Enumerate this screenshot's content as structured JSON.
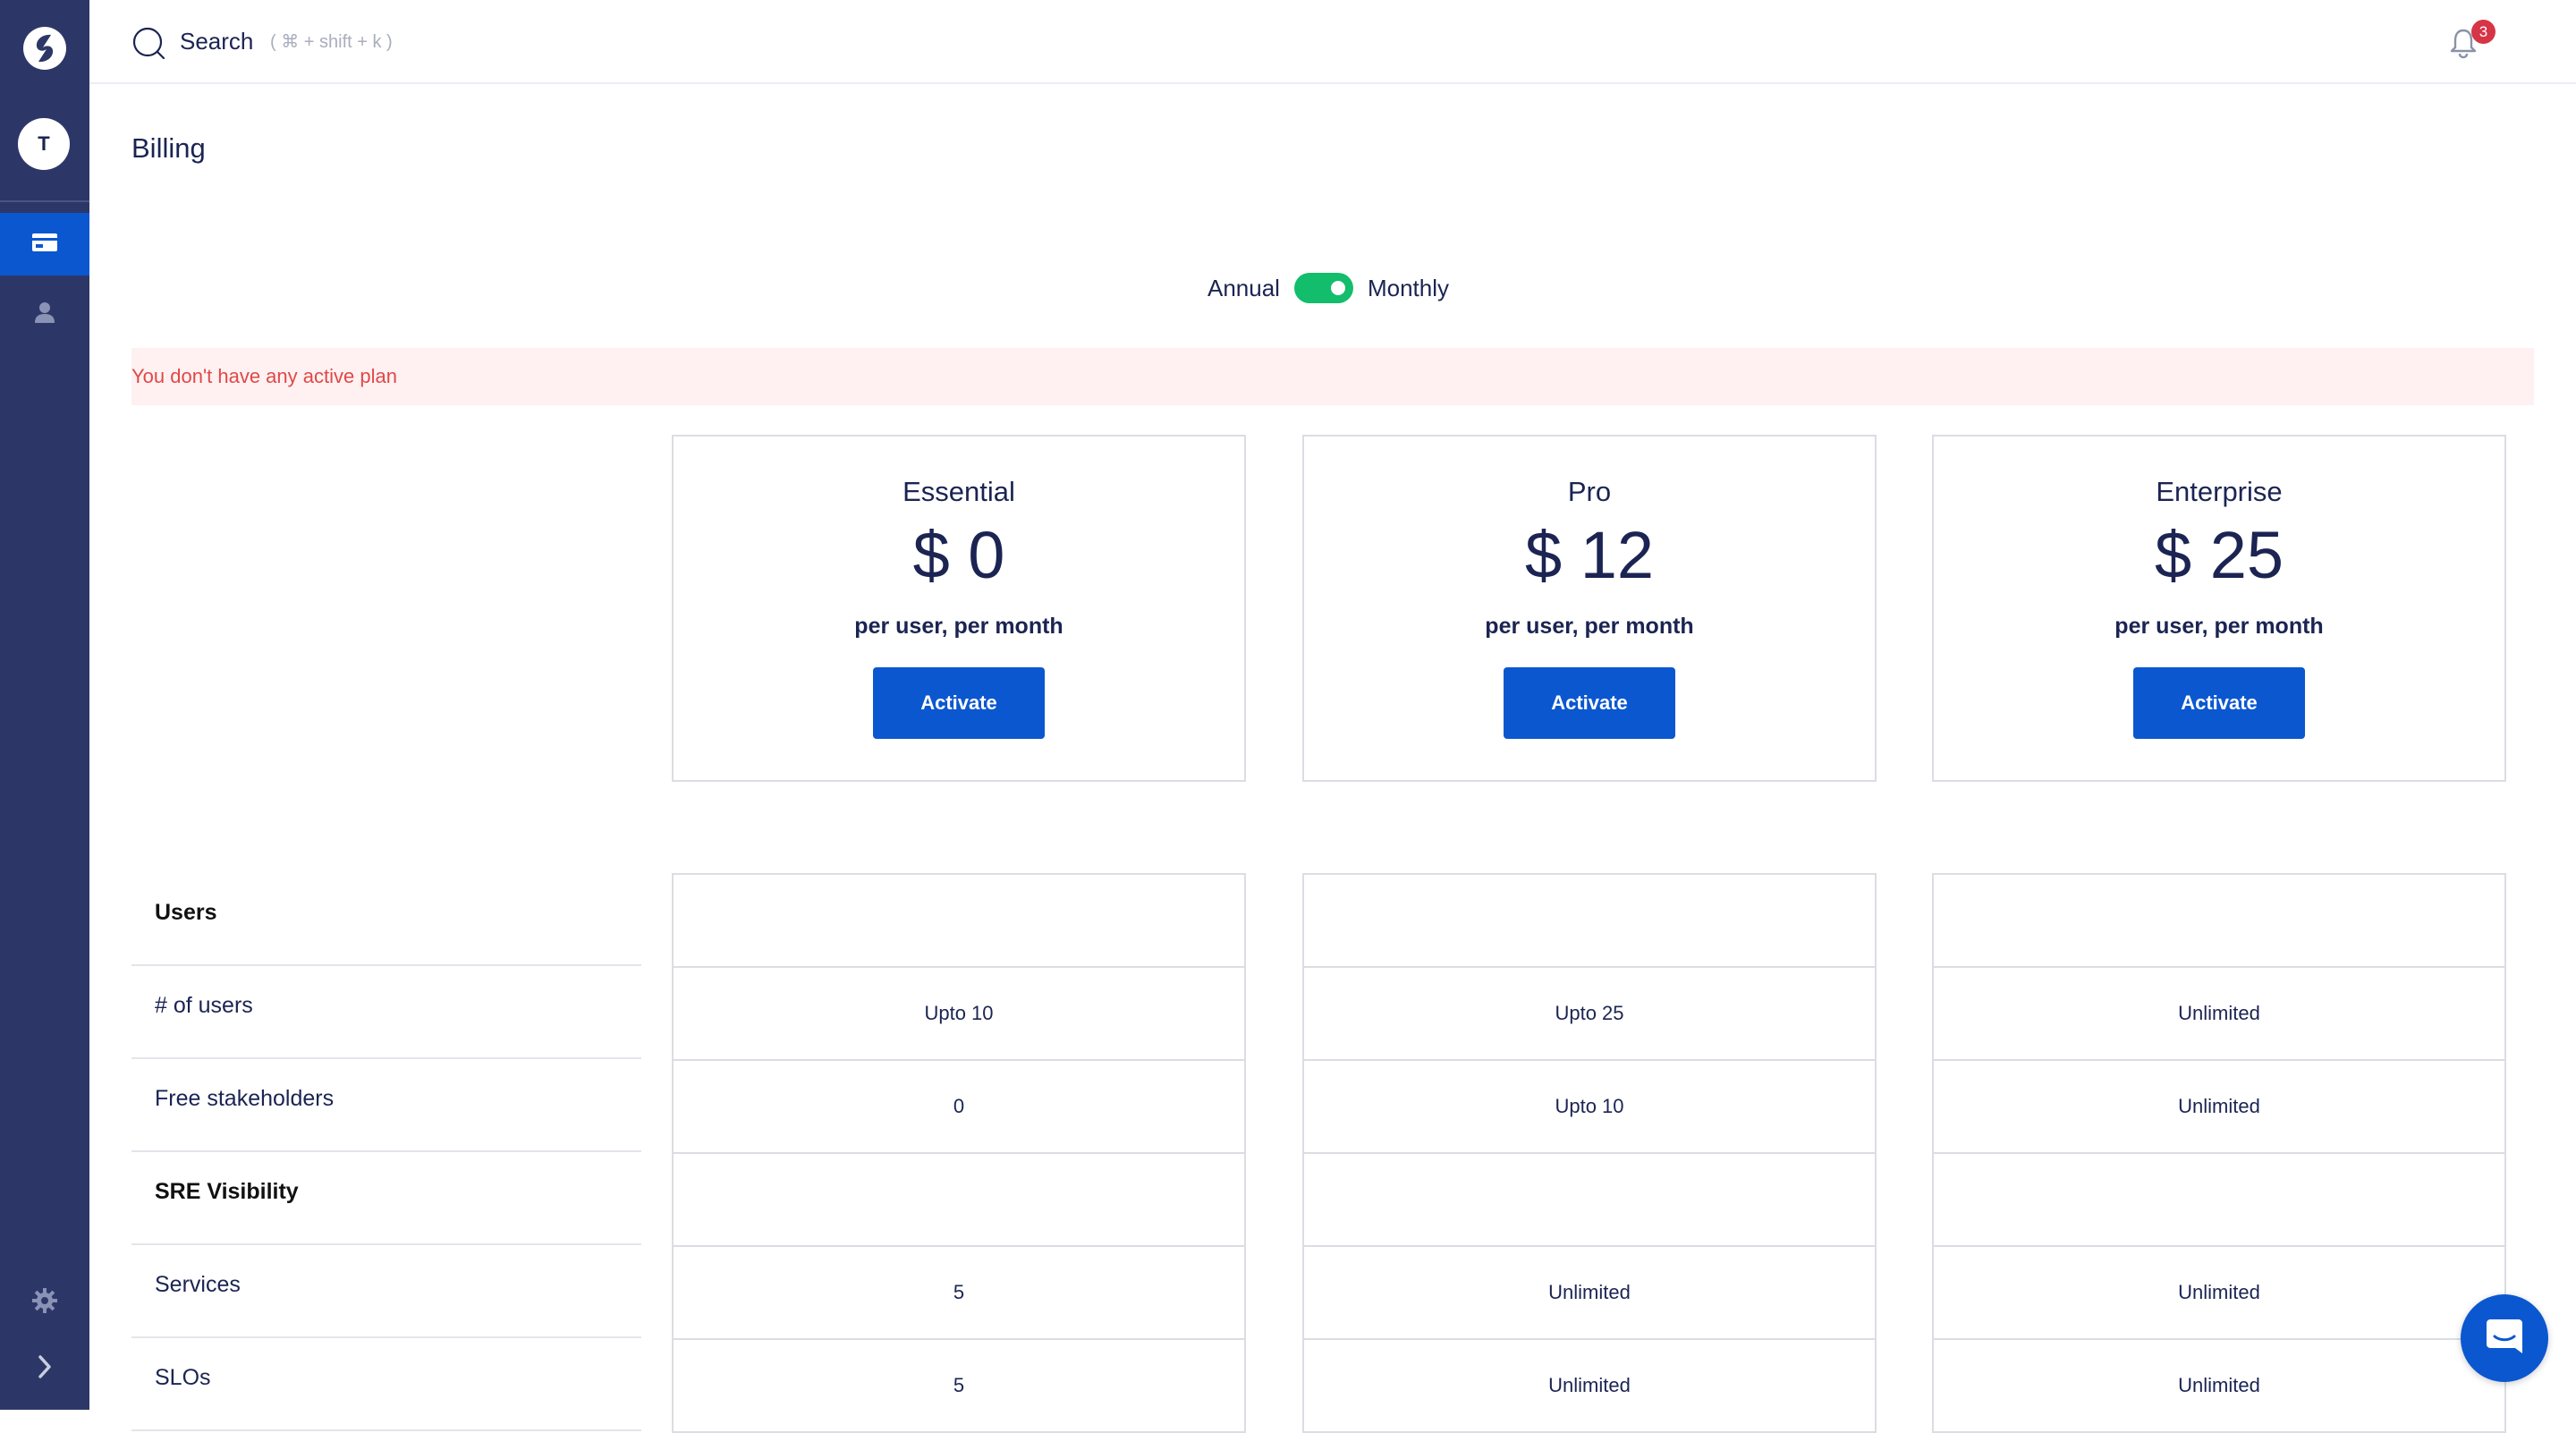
{
  "sidebar": {
    "avatar_initial": "T",
    "items": [
      {
        "name": "billing",
        "icon": "credit-card-icon",
        "active": true
      },
      {
        "name": "users",
        "icon": "person-icon",
        "active": false
      }
    ],
    "bottom": [
      {
        "name": "settings",
        "icon": "gear-icon"
      },
      {
        "name": "expand",
        "icon": "chevron-right-icon"
      }
    ]
  },
  "topbar": {
    "search_label": "Search",
    "search_shortcut": "( ⌘ + shift + k )",
    "notification_count": "3"
  },
  "page": {
    "title": "Billing"
  },
  "billing_toggle": {
    "left_label": "Annual",
    "right_label": "Monthly",
    "state": "monthly"
  },
  "alert": {
    "message": "You don't have any active plan"
  },
  "plans": [
    {
      "name": "Essential",
      "price": "$ 0",
      "unit": "per user, per month",
      "button": "Activate"
    },
    {
      "name": "Pro",
      "price": "$ 12",
      "unit": "per user, per month",
      "button": "Activate"
    },
    {
      "name": "Enterprise",
      "price": "$ 25",
      "unit": "per user, per month",
      "button": "Activate"
    }
  ],
  "features": {
    "rows": [
      {
        "label": "Users",
        "section": true,
        "values": [
          "",
          "",
          ""
        ]
      },
      {
        "label": "# of users",
        "section": false,
        "values": [
          "Upto 10",
          "Upto 25",
          "Unlimited"
        ]
      },
      {
        "label": "Free stakeholders",
        "section": false,
        "values": [
          "0",
          "Upto 10",
          "Unlimited"
        ]
      },
      {
        "label": "SRE Visibility",
        "section": true,
        "values": [
          "",
          "",
          ""
        ]
      },
      {
        "label": "Services",
        "section": false,
        "values": [
          "5",
          "Unlimited",
          "Unlimited"
        ]
      },
      {
        "label": "SLOs",
        "section": false,
        "values": [
          "5",
          "Unlimited",
          "Unlimited"
        ]
      }
    ]
  },
  "colors": {
    "sidebar_bg": "#2d3767",
    "primary": "#0b57d0",
    "toggle_on": "#12bd6c",
    "alert_bg": "#fff1f1",
    "alert_text": "#e04848",
    "badge": "#d63447"
  }
}
